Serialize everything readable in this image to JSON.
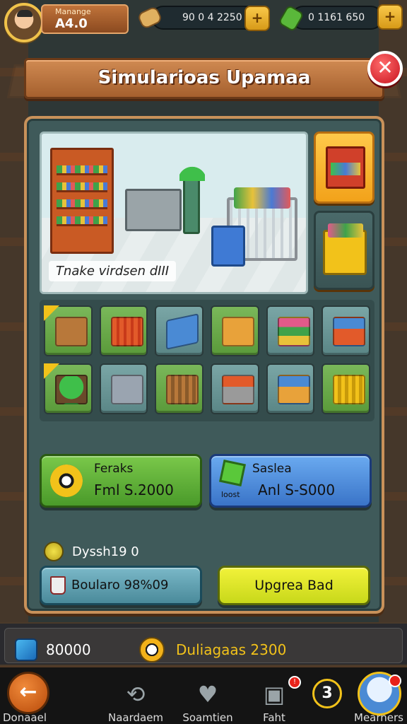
{
  "hud": {
    "player_name": "Manange",
    "player_level": "A4.0",
    "resource_1_value": "90 0 4 2250",
    "resource_2_value": "0 1161 650",
    "plus_label": "+"
  },
  "title": "Simularioas Upamaa",
  "close_label": "✕",
  "scene": {
    "caption": "Tnake virdsen dIII"
  },
  "grid_items": [
    {
      "name": "crate",
      "style": "green badge",
      "obj": "o-crate"
    },
    {
      "name": "cart-red",
      "style": "green",
      "obj": "o-cart"
    },
    {
      "name": "blue-bin",
      "style": "teal",
      "obj": "o-blue"
    },
    {
      "name": "produce-box",
      "style": "green",
      "obj": "o-box"
    },
    {
      "name": "stacked-goods",
      "style": "teal",
      "obj": "o-stack"
    },
    {
      "name": "basket-cart",
      "style": "teal",
      "obj": "o-basket"
    },
    {
      "name": "plant",
      "style": "green badge",
      "obj": "o-plant"
    },
    {
      "name": "register",
      "style": "teal",
      "obj": "o-register"
    },
    {
      "name": "wood-cart",
      "style": "green",
      "obj": "o-cart2"
    },
    {
      "name": "shopping-cart",
      "style": "teal",
      "obj": "o-cart3"
    },
    {
      "name": "supply-box",
      "style": "teal",
      "obj": "o-box2"
    },
    {
      "name": "yellow-cart",
      "style": "green",
      "obj": "o-cart4"
    }
  ],
  "buttons": {
    "green_title": "Feraks",
    "green_price": "Fml S.2000",
    "blue_title": "Saslea",
    "blue_small": "loost",
    "blue_price": "Anl S-S000",
    "info_text": "Dyssh19 0",
    "teal_label": "Boularo 98%09",
    "yellow_label": "Upgrea Bad"
  },
  "status": {
    "left_value": "80000",
    "right_value": "Duliagaas 2300"
  },
  "nav": {
    "back_label": "Donaael",
    "item1_label": "Naardaem",
    "item2_label": "Soamtien",
    "item3_label": "Faht",
    "count": "3",
    "chef_label": "Mearners",
    "back_glyph": "←"
  },
  "colors": {
    "accent_gold": "#f2c21a",
    "close_red": "#c8121e",
    "buy_green": "#4a9a2a",
    "sell_blue": "#3a74c8",
    "upgrade_yellow": "#c8d81a"
  }
}
